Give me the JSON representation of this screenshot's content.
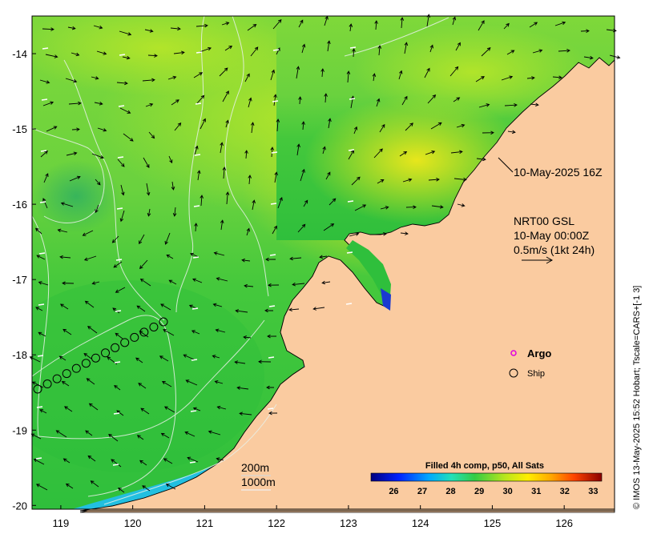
{
  "map": {
    "lon_ticks": [
      "119",
      "120",
      "121",
      "122",
      "123",
      "124",
      "125",
      "126"
    ],
    "lat_ticks": [
      "-14",
      "-15",
      "-16",
      "-17",
      "-18",
      "-19",
      "-20"
    ],
    "lon_range": [
      118.6,
      126.7
    ],
    "lat_range": [
      -20.05,
      -13.5
    ]
  },
  "annotations": {
    "timestamp": "10-May-2025 16Z",
    "nrt_line1": "NRT00 GSL",
    "nrt_line2": "10-May 00:00Z",
    "nrt_line3": "0.5m/s (1kt 24h)",
    "contour_200": "200m",
    "contour_1000": "1000m"
  },
  "legend": {
    "argo": "Argo",
    "ship": "Ship"
  },
  "colorbar": {
    "title": "Filled 4h comp, p50, All Sats",
    "ticks": [
      "26",
      "27",
      "28",
      "29",
      "30",
      "31",
      "32",
      "33"
    ],
    "range": [
      25.2,
      33.3
    ]
  },
  "credit": "© IMOS 13-May-2025 15:52 Hobart; Tscale=CARS+[-1 3]",
  "colors": {
    "land": "#FACBA0",
    "ocean_green": "#3DCB3D",
    "ocean_yellow": "#E4EC18",
    "argo": "#E000E0"
  }
}
